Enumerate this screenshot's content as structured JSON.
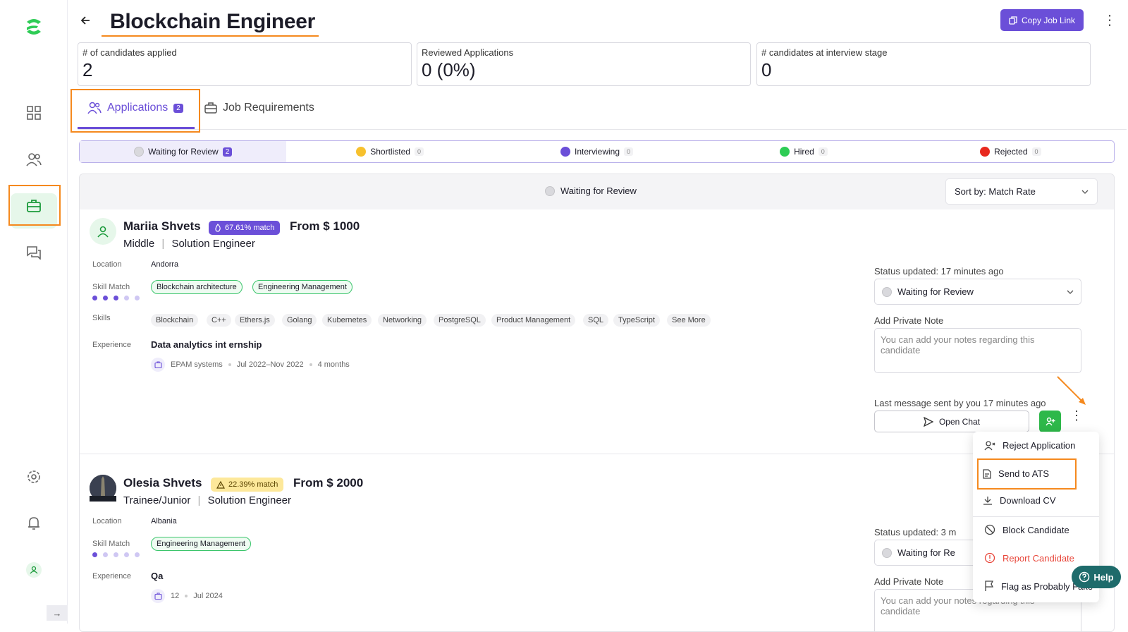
{
  "sidebar": {
    "items": [
      {
        "icon": "logo-icon"
      },
      {
        "icon": "dashboard-icon"
      },
      {
        "icon": "users-icon"
      },
      {
        "icon": "briefcase-icon"
      },
      {
        "icon": "messages-icon"
      },
      {
        "icon": "settings-icon"
      },
      {
        "icon": "bell-icon"
      },
      {
        "icon": "profile-icon"
      }
    ],
    "collapse_label": "→"
  },
  "header": {
    "title": "Blockchain Engineer",
    "copy_button": "Copy Job Link",
    "kebab": "⋮"
  },
  "stats": [
    {
      "label": "# of candidates applied",
      "value": "2"
    },
    {
      "label": "Reviewed Applications",
      "value": "0 (0%)"
    },
    {
      "label": "# candidates at interview stage",
      "value": "0"
    }
  ],
  "tabs": [
    {
      "label": "Applications",
      "count": "2"
    },
    {
      "label": "Job Requirements"
    }
  ],
  "status_filters": [
    {
      "label": "Waiting for Review",
      "count": "2",
      "color": "#d9d9dd"
    },
    {
      "label": "Shortlisted",
      "count": "0",
      "color": "#f7c12e"
    },
    {
      "label": "Interviewing",
      "count": "0",
      "color": "#6b4fd8"
    },
    {
      "label": "Hired",
      "count": "0",
      "color": "#2ecc55"
    },
    {
      "label": "Rejected",
      "count": "0",
      "color": "#e8291f"
    }
  ],
  "list": {
    "group_label": "Waiting for Review",
    "sort_label": "Sort by: Match Rate"
  },
  "candidates": [
    {
      "name": "Mariia Shvets",
      "match": "67.61% match",
      "price": "From $ 1000",
      "level": "Middle",
      "role": "Solution Engineer",
      "location_label": "Location",
      "location": "Andorra",
      "skill_match_label": "Skill Match",
      "skill_match": [
        "Blockchain architecture",
        "Engineering Management"
      ],
      "skills_label": "Skills",
      "skills": [
        "Blockchain",
        "C++",
        "Ethers.js",
        "Golang",
        "Kubernetes",
        "Networking",
        "PostgreSQL",
        "Product Management",
        "SQL",
        "TypeScript",
        "See More"
      ],
      "experience_label": "Experience",
      "experience_title": "Data analytics int ernship",
      "experience_company": "EPAM systems",
      "experience_dates": "Jul 2022–Nov 2022",
      "experience_duration": "4 months",
      "status_updated": "Status updated: 17 minutes ago",
      "status": "Waiting for Review",
      "note_label": "Add Private Note",
      "note_placeholder": "You can add your notes regarding this candidate",
      "last_message": "Last message sent by you 17 minutes ago",
      "open_chat": "Open Chat"
    },
    {
      "name": "Olesia Shvets",
      "match": "22.39% match",
      "price": "From $ 2000",
      "level": "Trainee/Junior",
      "role": "Solution Engineer",
      "location_label": "Location",
      "location": "Albania",
      "skill_match_label": "Skill Match",
      "skill_match": [
        "Engineering Management"
      ],
      "experience_label": "Experience",
      "experience_title": "Qa",
      "experience_company": "12",
      "experience_dates": "Jul 2024",
      "status_updated": "Status updated: 3 m",
      "status": "Waiting for Re",
      "note_label": "Add Private Note",
      "note_placeholder": "You can add your notes regarding this candidate"
    }
  ],
  "context_menu": {
    "items": [
      {
        "label": "Reject Application"
      },
      {
        "label": "Send to ATS"
      },
      {
        "label": "Download CV"
      },
      {
        "label": "Block Candidate"
      },
      {
        "label": "Report Candidate"
      },
      {
        "label": "Flag as Probably Fake"
      }
    ]
  },
  "help": {
    "label": "Help"
  }
}
